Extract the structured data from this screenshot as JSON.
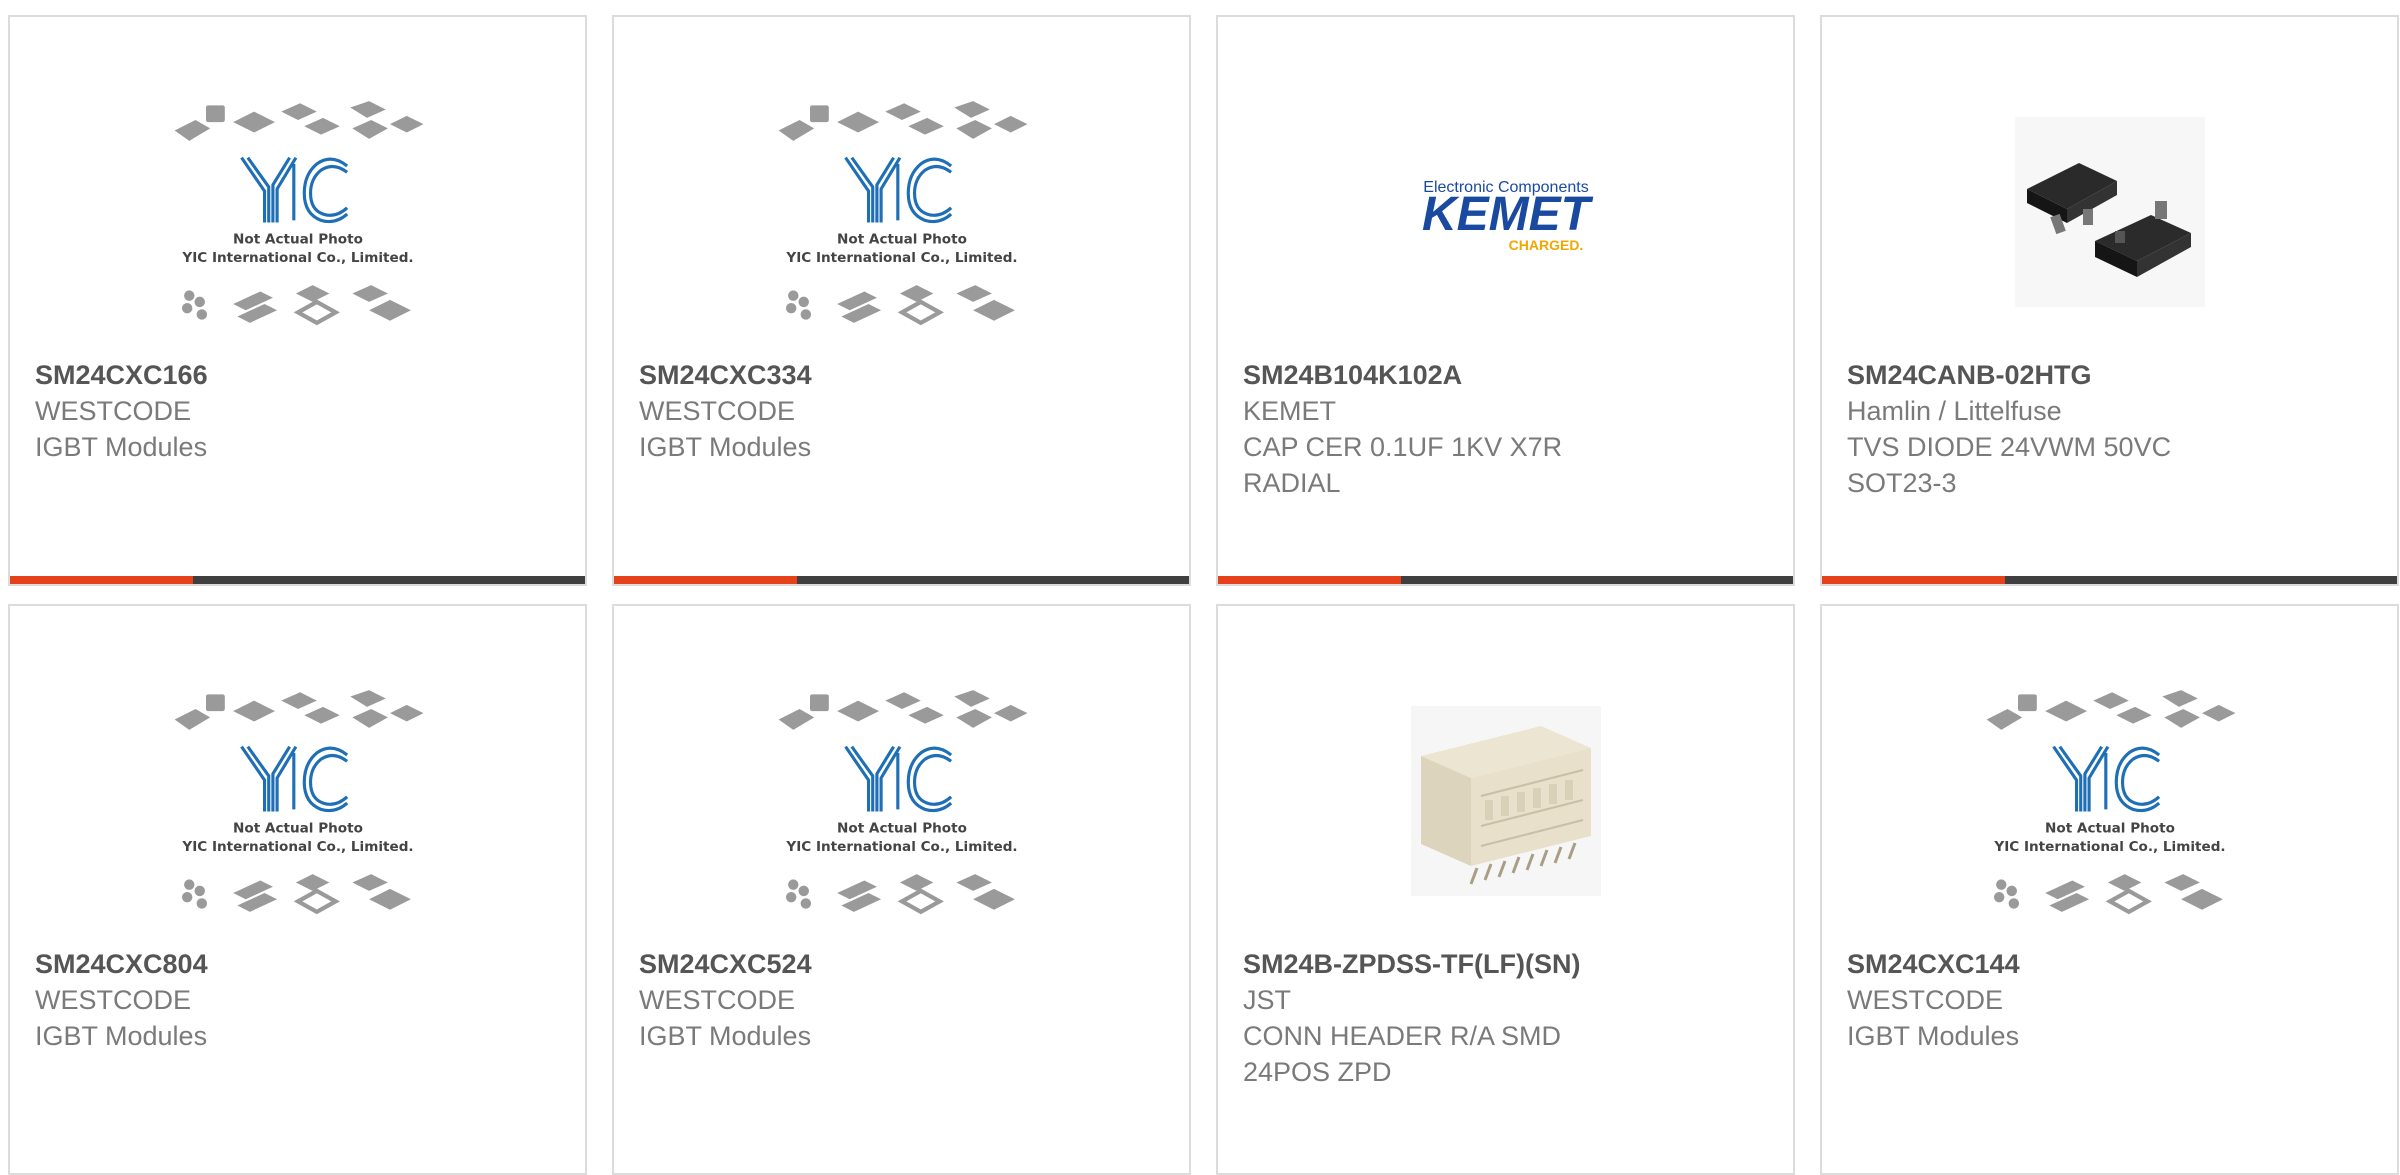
{
  "colors": {
    "accent": "#e5421b",
    "bar": "#3f3f3f",
    "part_number": "#555555",
    "text": "#7a7a7a",
    "card_border": "#dcdcdc",
    "yic_logo_blue": "#1e6fb5",
    "kemet_blue": "#1a4aa0",
    "kemet_yellow": "#f0a800"
  },
  "placeholder_image": {
    "logo_text": "YIC",
    "line1": "Not Actual Photo",
    "line2": "YIC International Co., Limited."
  },
  "kemet_logo": {
    "top": "Electronic Components",
    "brand": "KEMET",
    "tag": "CHARGED."
  },
  "products": [
    {
      "part": "SM24CXC166",
      "manufacturer": "WESTCODE",
      "description": "IGBT Modules",
      "image": "yic-placeholder"
    },
    {
      "part": "SM24CXC334",
      "manufacturer": "WESTCODE",
      "description": "IGBT Modules",
      "image": "yic-placeholder"
    },
    {
      "part": "SM24B104K102A",
      "manufacturer": "KEMET",
      "description": "CAP CER 0.1UF 1KV X7R RADIAL",
      "image": "kemet-logo"
    },
    {
      "part": "SM24CANB-02HTG",
      "manufacturer": "Hamlin / Littelfuse",
      "description": "TVS DIODE 24VWM 50VC SOT23-3",
      "image": "sot23-photo"
    },
    {
      "part": "SM24CXC804",
      "manufacturer": "WESTCODE",
      "description": "IGBT Modules",
      "image": "yic-placeholder"
    },
    {
      "part": "SM24CXC524",
      "manufacturer": "WESTCODE",
      "description": "IGBT Modules",
      "image": "yic-placeholder"
    },
    {
      "part": "SM24B-ZPDSS-TF(LF)(SN)",
      "manufacturer": "JST",
      "description": "CONN HEADER R/A SMD 24POS ZPD",
      "image": "connector-photo"
    },
    {
      "part": "SM24CXC144",
      "manufacturer": "WESTCODE",
      "description": "IGBT Modules",
      "image": "yic-placeholder"
    }
  ]
}
